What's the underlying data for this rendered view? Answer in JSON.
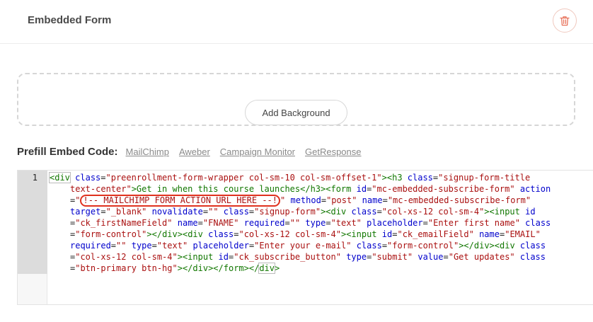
{
  "header": {
    "title": "Embedded Form",
    "delete_icon": "trash-icon"
  },
  "background": {
    "add_label": "Add Background"
  },
  "prefill": {
    "label": "Prefill Embed Code:",
    "links": [
      "MailChimp",
      "Aweber",
      "Campaign Monitor",
      "GetResponse"
    ]
  },
  "editor": {
    "line_number": "1",
    "highlight_color": "#e0311e",
    "code": {
      "l1": {
        "a": "<div",
        "b": " ",
        "c": "class",
        "d": "=",
        "e": "\"preenrollment-form-wrapper col-sm-10 col-sm-offset-1\"",
        "f": "><h3",
        "g": " ",
        "h": "class",
        "i": "=",
        "j": "\"signup-form-title"
      },
      "l2": {
        "a": "text-center\"",
        "b": ">Get in when this course launches",
        "c": "</h3><form",
        "d": " ",
        "e": "id",
        "f": "=",
        "g": "\"mc-embedded-subscribe-form\"",
        "h": " ",
        "i": "action"
      },
      "l3": {
        "a": "=",
        "b": "\"",
        "c": "!-- MAILCHIMP FORM ACTION URL HERE --!",
        "d": "\"",
        "e": " ",
        "f": "method",
        "g": "=",
        "h": "\"post\"",
        "i": " ",
        "j": "name",
        "k": "=",
        "l": "\"mc-embedded-subscribe-form\""
      },
      "l4": {
        "a": "target",
        "b": "=",
        "c": "\"_blank\"",
        "d": " ",
        "e": "novalidate",
        "f": "=",
        "g": "\"\"",
        "h": " ",
        "i": "class",
        "j": "=",
        "k": "\"signup-form\"",
        "l": "><div",
        "m": " ",
        "n": "class",
        "o": "=",
        "p": "\"col-xs-12 col-sm-4\"",
        "q": "><input",
        "r": " ",
        "s": "id"
      },
      "l5": {
        "a": "=",
        "b": "\"ck_firstNameField\"",
        "c": " ",
        "d": "name",
        "e": "=",
        "f": "\"FNAME\"",
        "g": " ",
        "h": "required",
        "i": "=",
        "j": "\"\"",
        "k": " ",
        "l": "type",
        "m": "=",
        "n": "\"text\"",
        "o": " ",
        "p": "placeholder",
        "q": "=",
        "r": "\"Enter first name\"",
        "s": " ",
        "t": "class"
      },
      "l6": {
        "a": "=",
        "b": "\"form-control\"",
        "c": "></div><div",
        "d": " ",
        "e": "class",
        "f": "=",
        "g": "\"col-xs-12 col-sm-4\"",
        "h": "><input",
        "i": " ",
        "j": "id",
        "k": "=",
        "l": "\"ck_emailField\"",
        "m": " ",
        "n": "name",
        "o": "=",
        "p": "\"EMAIL\""
      },
      "l7": {
        "a": "required",
        "b": "=",
        "c": "\"\"",
        "d": " ",
        "e": "type",
        "f": "=",
        "g": "\"text\"",
        "h": " ",
        "i": "placeholder",
        "j": "=",
        "k": "\"Enter your e-mail\"",
        "l": " ",
        "m": "class",
        "n": "=",
        "o": "\"form-control\"",
        "p": "></div><div",
        "q": " ",
        "r": "class"
      },
      "l8": {
        "a": "=",
        "b": "\"col-xs-12 col-sm-4\"",
        "c": "><input",
        "d": " ",
        "e": "id",
        "f": "=",
        "g": "\"ck_subscribe_button\"",
        "h": " ",
        "i": "type",
        "j": "=",
        "k": "\"submit\"",
        "l": " ",
        "m": "value",
        "n": "=",
        "o": "\"Get updates\"",
        "p": " ",
        "q": "class"
      },
      "l9": {
        "a": "=",
        "b": "\"btn-primary btn-hg\"",
        "c": "></div></form></",
        "d": "div",
        "e": ">"
      }
    }
  }
}
